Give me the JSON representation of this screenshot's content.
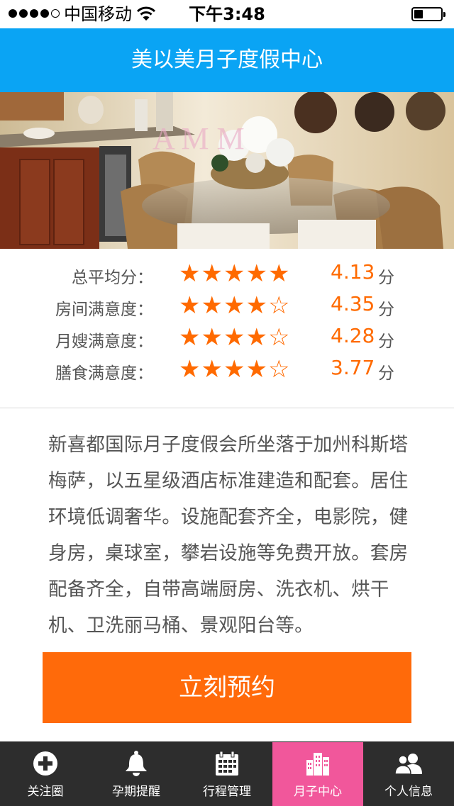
{
  "status_bar": {
    "carrier": "中国移动",
    "time": "下午3:48"
  },
  "nav": {
    "title": "美以美月子度假中心"
  },
  "hero": {
    "watermark": "A M M"
  },
  "ratings": [
    {
      "label": "总平均分：",
      "stars": 5,
      "score": "4.13",
      "unit": "分"
    },
    {
      "label": "房间满意度：",
      "stars": 4,
      "score": "4.35",
      "unit": "分"
    },
    {
      "label": "月嫂满意度：",
      "stars": 4,
      "score": "4.28",
      "unit": "分"
    },
    {
      "label": "膳食满意度：",
      "stars": 4,
      "score": "3.77",
      "unit": "分"
    }
  ],
  "description": "新喜都国际月子度假会所坐落于加州科斯塔梅萨，以五星级酒店标准建造和配套。居住环境低调奢华。设施配套齐全，电影院，健身房，桌球室，攀岩设施等免费开放。套房配备齐全，自带高端厨房、洗衣机、烘干机、卫洗丽马桶、景观阳台等。",
  "book_button": {
    "label": "立刻预约"
  },
  "tab_bar": {
    "items": [
      {
        "label": "关注圈",
        "icon": "plus-circle-icon"
      },
      {
        "label": "孕期提醒",
        "icon": "bell-icon"
      },
      {
        "label": "行程管理",
        "icon": "calendar-icon"
      },
      {
        "label": "月子中心",
        "icon": "buildings-icon",
        "active": true
      },
      {
        "label": "个人信息",
        "icon": "users-icon"
      }
    ]
  },
  "colors": {
    "nav": "#0aa4f4",
    "accent": "#ff6a0a",
    "tab_active": "#f1579b",
    "tab_bg": "#2d2d2d"
  }
}
